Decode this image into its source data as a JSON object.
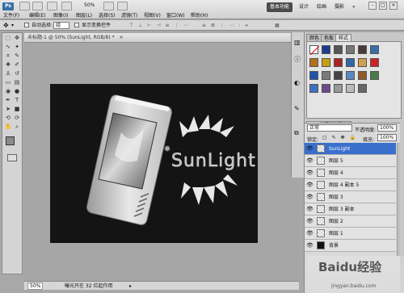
{
  "app": {
    "logo": "Ps",
    "zoom": "50%"
  },
  "menu": [
    "文件(F)",
    "编辑(E)",
    "图像(I)",
    "图层(L)",
    "选择(S)",
    "滤镜(T)",
    "视图(V)",
    "窗口(W)",
    "帮助(H)"
  ],
  "workspaces": [
    "基本功能",
    "设计",
    "绘画",
    "摄影"
  ],
  "workspace_more": "»",
  "window_controls": [
    "-",
    "□",
    "×"
  ],
  "options": {
    "auto_select_label": "自动选择:",
    "auto_select_value": "组",
    "show_transform_label": "显示变换控件"
  },
  "document": {
    "tab_title": "未标题-1 @ 50% (SunLight, RGB/8) *",
    "close": "×",
    "artwork_text": "SunLight"
  },
  "status": {
    "zoom": "50%",
    "info": "曝光只在 32 位起作用"
  },
  "panels": {
    "top_tabs": [
      "颜色",
      "色板",
      "样式"
    ],
    "bottom_tabs": [
      "图层",
      "通道",
      "路径"
    ]
  },
  "layers": {
    "blend_mode": "正常",
    "opacity_label": "不透明度:",
    "opacity": "100%",
    "lock_label": "锁定:",
    "fill_label": "填充:",
    "fill": "100%",
    "items": [
      {
        "name": "SunLight",
        "selected": true
      },
      {
        "name": "图层 5",
        "selected": false
      },
      {
        "name": "图层 4",
        "selected": false
      },
      {
        "name": "图层 4 副本 5",
        "selected": false
      },
      {
        "name": "图层 3",
        "selected": false
      },
      {
        "name": "图层 3 副本",
        "selected": false
      },
      {
        "name": "图层 2",
        "selected": false
      },
      {
        "name": "图层 1",
        "selected": false
      },
      {
        "name": "背景",
        "selected": false
      }
    ]
  },
  "watermark": {
    "brand": "Baidu经验",
    "url": "jingyan.baidu.com"
  },
  "colors": {
    "selected_layer": "#3a6fcc",
    "canvas": "#141414",
    "active_workspace": "#4a4a4a"
  }
}
